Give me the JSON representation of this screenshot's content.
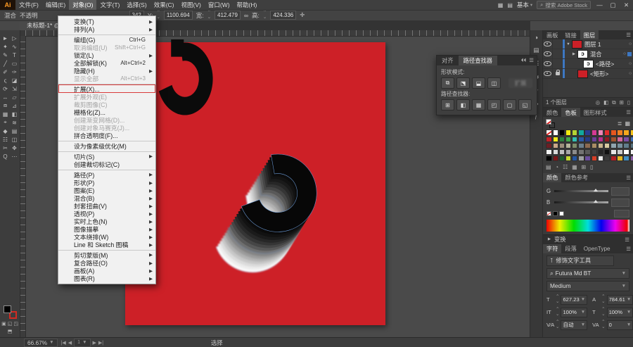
{
  "window": {
    "logo": "Ai",
    "menus": [
      {
        "label": "文件(F)"
      },
      {
        "label": "编辑(E)"
      },
      {
        "label": "对象(O)",
        "active": true
      },
      {
        "label": "文字(T)"
      },
      {
        "label": "选择(S)"
      },
      {
        "label": "效果(C)"
      },
      {
        "label": "视图(V)"
      },
      {
        "label": "窗口(W)"
      },
      {
        "label": "帮助(H)"
      }
    ],
    "workspace": "基本",
    "search_label": "搜索 Adobe Stock",
    "minimize": "—",
    "maximize": "▢",
    "close": "✕"
  },
  "control_bar": {
    "object": "混合",
    "opacity": "不透明",
    "x_partial": "342",
    "y_label": "Y:",
    "y": "1100.694",
    "w_label": "宽:",
    "w": "412.479",
    "h_label": "高:",
    "h": "424.336"
  },
  "doc_tab": {
    "title": "未标题-1* @"
  },
  "object_menu": {
    "items": [
      {
        "label": "变换(T)",
        "sub": true
      },
      {
        "label": "排列(A)",
        "sub": true
      },
      {
        "label": "编组(G)",
        "shortcut": "Ctrl+G",
        "sep": true
      },
      {
        "label": "取消编组(U)",
        "shortcut": "Shift+Ctrl+G",
        "disabled": true
      },
      {
        "label": "锁定(L)",
        "sub": true
      },
      {
        "label": "全部解锁(K)",
        "shortcut": "Alt+Ctrl+2"
      },
      {
        "label": "隐藏(H)",
        "sub": true
      },
      {
        "label": "显示全部",
        "shortcut": "Alt+Ctrl+3",
        "disabled": true
      },
      {
        "label": "扩展(X)...",
        "marked": true,
        "sep": true
      },
      {
        "label": "扩展外观(E)",
        "disabled": true
      },
      {
        "label": "裁剪图像(C)",
        "disabled": true
      },
      {
        "label": "栅格化(Z)..."
      },
      {
        "label": "创建渐变网格(D)...",
        "disabled": true
      },
      {
        "label": "创建对象马赛克(J)...",
        "disabled": true
      },
      {
        "label": "拼合透明度(F)..."
      },
      {
        "label": "设为像素级优化(M)",
        "sep": true
      },
      {
        "label": "切片(S)",
        "sub": true,
        "sep": true
      },
      {
        "label": "创建裁切标记(C)"
      },
      {
        "label": "路径(P)",
        "sub": true,
        "sep": true
      },
      {
        "label": "形状(P)",
        "sub": true
      },
      {
        "label": "图案(E)",
        "sub": true
      },
      {
        "label": "混合(B)",
        "sub": true
      },
      {
        "label": "封套扭曲(V)",
        "sub": true
      },
      {
        "label": "透视(P)",
        "sub": true
      },
      {
        "label": "实时上色(N)",
        "sub": true
      },
      {
        "label": "图像描摹",
        "sub": true
      },
      {
        "label": "文本绕排(W)",
        "sub": true
      },
      {
        "label": "Line 和 Sketch 图稿",
        "sub": true
      },
      {
        "label": "剪切蒙版(M)",
        "sub": true,
        "sep": true
      },
      {
        "label": "复合路径(O)",
        "sub": true
      },
      {
        "label": "画板(A)",
        "sub": true
      },
      {
        "label": "图表(R)",
        "sub": true
      }
    ]
  },
  "toolbar": {
    "tools": [
      {
        "glyph": "►",
        "name": "selection-tool"
      },
      {
        "glyph": "▷",
        "name": "direct-selection-tool"
      },
      {
        "glyph": "✦",
        "name": "magic-wand-tool"
      },
      {
        "glyph": "∿",
        "name": "lasso-tool"
      },
      {
        "glyph": "✎",
        "name": "pen-tool"
      },
      {
        "glyph": "T",
        "name": "type-tool"
      },
      {
        "glyph": "╱",
        "name": "line-segment-tool"
      },
      {
        "glyph": "▭",
        "name": "rectangle-tool"
      },
      {
        "glyph": "✐",
        "name": "paintbrush-tool"
      },
      {
        "glyph": "✑",
        "name": "pencil-tool"
      },
      {
        "glyph": "ς",
        "name": "shaper-tool"
      },
      {
        "glyph": "◪",
        "name": "eraser-tool"
      },
      {
        "glyph": "⟳",
        "name": "rotate-tool"
      },
      {
        "glyph": "⇲",
        "name": "scale-tool"
      },
      {
        "glyph": "↔",
        "name": "width-tool"
      },
      {
        "glyph": "▱",
        "name": "free-transform-tool"
      },
      {
        "glyph": "⧈",
        "name": "shape-builder-tool"
      },
      {
        "glyph": "⊿",
        "name": "perspective-grid-tool"
      },
      {
        "glyph": "▦",
        "name": "mesh-tool"
      },
      {
        "glyph": "◧",
        "name": "gradient-tool"
      },
      {
        "glyph": "⌖",
        "name": "eyedropper-tool"
      },
      {
        "glyph": "≋",
        "name": "blend-tool"
      },
      {
        "glyph": "◆",
        "name": "symbol-sprayer-tool"
      },
      {
        "glyph": "▤",
        "name": "column-graph-tool"
      },
      {
        "glyph": "☷",
        "name": "artboard-tool"
      },
      {
        "glyph": "◫",
        "name": "slice-tool"
      },
      {
        "glyph": "✂",
        "name": "scissors-tool"
      },
      {
        "glyph": "✥",
        "name": "hand-tool"
      },
      {
        "glyph": "Q",
        "name": "zoom-tool"
      },
      {
        "glyph": "⋯",
        "name": "more-tools"
      }
    ]
  },
  "pathfinder_panel": {
    "tabs": [
      {
        "label": "对齐"
      },
      {
        "label": "路径查找器",
        "active": true
      }
    ],
    "header_icons": [
      {
        "glyph": "⏴⏴",
        "name": "collapse-icon"
      },
      {
        "glyph": "☰",
        "name": "panel-menu-icon"
      }
    ],
    "shape_label": "形状模式:",
    "shape_buttons": [
      {
        "glyph": "⧉",
        "name": "unite-button"
      },
      {
        "glyph": "⬔",
        "name": "minus-front-button"
      },
      {
        "glyph": "⬓",
        "name": "intersect-button"
      },
      {
        "glyph": "◫",
        "name": "exclude-button"
      }
    ],
    "expand_label": "扩展",
    "pf_label": "路径查找器:",
    "pf_buttons": [
      {
        "glyph": "⊞",
        "name": "divide-button"
      },
      {
        "glyph": "◧",
        "name": "trim-button"
      },
      {
        "glyph": "▦",
        "name": "merge-button"
      },
      {
        "glyph": "◰",
        "name": "crop-button"
      },
      {
        "glyph": "▢",
        "name": "outline-button"
      },
      {
        "glyph": "◱",
        "name": "minus-back-button"
      }
    ]
  },
  "dock": {
    "strip_icons": [
      {
        "glyph": "◑",
        "name": "color-panel-icon"
      },
      {
        "glyph": "▤",
        "name": "libraries-panel-icon"
      },
      {
        "glyph": "☰",
        "name": "properties-panel-icon"
      },
      {
        "glyph": "⇆",
        "name": "transform-panel-icon"
      },
      {
        "glyph": "✦",
        "name": "brushes-panel-icon"
      },
      {
        "glyph": "♣",
        "name": "symbols-panel-icon"
      },
      {
        "glyph": "ƒ",
        "name": "appearance-panel-icon"
      }
    ],
    "layers": {
      "tabs": [
        {
          "label": "画板"
        },
        {
          "label": "链接"
        },
        {
          "label": "图层",
          "active": true
        }
      ],
      "rows": [
        {
          "name": "图层 1",
          "cls": "ind0",
          "caret": "▼",
          "eye": true,
          "thumbcls": "thumb-red",
          "target": "○"
        },
        {
          "name": "混合",
          "cls": "ind1",
          "caret": "▶",
          "eye": true,
          "thumbcls": "thumb-shape",
          "target": "○",
          "selected": true
        },
        {
          "name": "<路径>",
          "cls": "ind2",
          "eye": true,
          "thumbcls": "thumb-shape",
          "target": "○"
        },
        {
          "name": "<矩形>",
          "cls": "ind1",
          "eye": true,
          "lock": true,
          "thumbcls": "thumb-red",
          "target": "○"
        }
      ],
      "count_label": "1 个图层",
      "foot_icons": [
        {
          "glyph": "◎",
          "name": "locate-object-icon"
        },
        {
          "glyph": "◧",
          "name": "make-mask-icon"
        },
        {
          "glyph": "⧉",
          "name": "new-sublayer-icon"
        },
        {
          "glyph": "⊞",
          "name": "new-layer-icon"
        },
        {
          "glyph": "▯",
          "name": "delete-layer-icon"
        }
      ]
    },
    "swatches": {
      "tabs": [
        {
          "label": "颜色"
        },
        {
          "label": "色板",
          "active": true
        },
        {
          "label": "图形样式"
        }
      ],
      "view_icons": [
        {
          "glyph": "≣",
          "name": "list-view-icon"
        },
        {
          "glyph": "▦",
          "name": "grid-view-icon"
        }
      ],
      "grid": [
        "none",
        "#ffffff",
        "#000000",
        "#f0ea10",
        "#b5d334",
        "#12a89d",
        "#2a3b8f",
        "#d53a93",
        "#ec84b6",
        "#e02a2a",
        "#e5571f",
        "#ef8022",
        "#f4a81d",
        "#f6c41c",
        "#c22026",
        "#f3ec19",
        "#2c7f3f",
        "#41a648",
        "#31bdb3",
        "#2b58a5",
        "#283a84",
        "#6c3f98",
        "#b52d8c",
        "#8c1a20",
        "#a0522d",
        "#d2699a",
        "#7b4ea3",
        "#3f6fb4",
        "#6b1e24",
        "#caa789",
        "#9c8f7c",
        "#b4b49a",
        "#7c8c6a",
        "#6b7f8c",
        "#8c6a50",
        "#a88c64",
        "#c8b48c",
        "#d8cca0",
        "#90a4ae",
        "#78909c",
        "#607d8b",
        "#546e7a",
        "#f2f2f2",
        "#d9d9d9",
        "#bfbfbf",
        "#a6a6a6",
        "#8c8c8c",
        "#737373",
        "#595959",
        "#404040",
        "#262626",
        "#111111",
        "#e6e6e6",
        "#cccccc",
        "#ffffff",
        "#f7f7f7",
        "#000000",
        "#7a1518",
        "#1e5c2e",
        "#c5d92d",
        "#2456a2",
        "#9ea0a3",
        "#6a4d9e",
        "#d43f27",
        "#e9e9e9",
        "#3b3b3b",
        "#b02025",
        "#e3b71e",
        "#3f8fc5",
        "#8b5ea6"
      ],
      "foot_icons": [
        {
          "glyph": "▤",
          "name": "swatch-libraries-icon"
        },
        {
          "glyph": "◔",
          "name": "color-themes-icon"
        },
        {
          "glyph": "☷",
          "name": "swatch-kinds-icon"
        },
        {
          "glyph": "▦",
          "name": "new-color-group-icon"
        },
        {
          "glyph": "⊞",
          "name": "new-swatch-icon"
        },
        {
          "glyph": "▯",
          "name": "delete-swatch-icon"
        }
      ]
    },
    "color": {
      "tabs": [
        {
          "label": "颜色",
          "active": true
        },
        {
          "label": "颜色参考"
        }
      ],
      "sliders": [
        {
          "letter": "G"
        },
        {
          "letter": "B"
        }
      ]
    },
    "transform": {
      "label": "变换"
    },
    "character": {
      "tabs": [
        {
          "label": "字符",
          "active": true
        },
        {
          "label": "段落"
        },
        {
          "label": "OpenType"
        }
      ],
      "touch_label": "修饰文字工具",
      "font": "Futura Md BT",
      "style": "Medium",
      "fields": [
        {
          "icon": "T",
          "value": "627.23",
          "name": "font-size-field"
        },
        {
          "icon": "A",
          "value": "784.61",
          "name": "leading-field"
        },
        {
          "icon": "IT",
          "value": "100%",
          "name": "vertical-scale-field"
        },
        {
          "icon": "T",
          "value": "100%",
          "name": "horizontal-scale-field"
        },
        {
          "icon": "V∕A",
          "value": "自动",
          "name": "kerning-field"
        },
        {
          "icon": "VA",
          "value": "0",
          "name": "tracking-field"
        }
      ]
    }
  },
  "status_bar": {
    "zoom": "66.67%",
    "artboard": "1",
    "tool": "选择"
  }
}
